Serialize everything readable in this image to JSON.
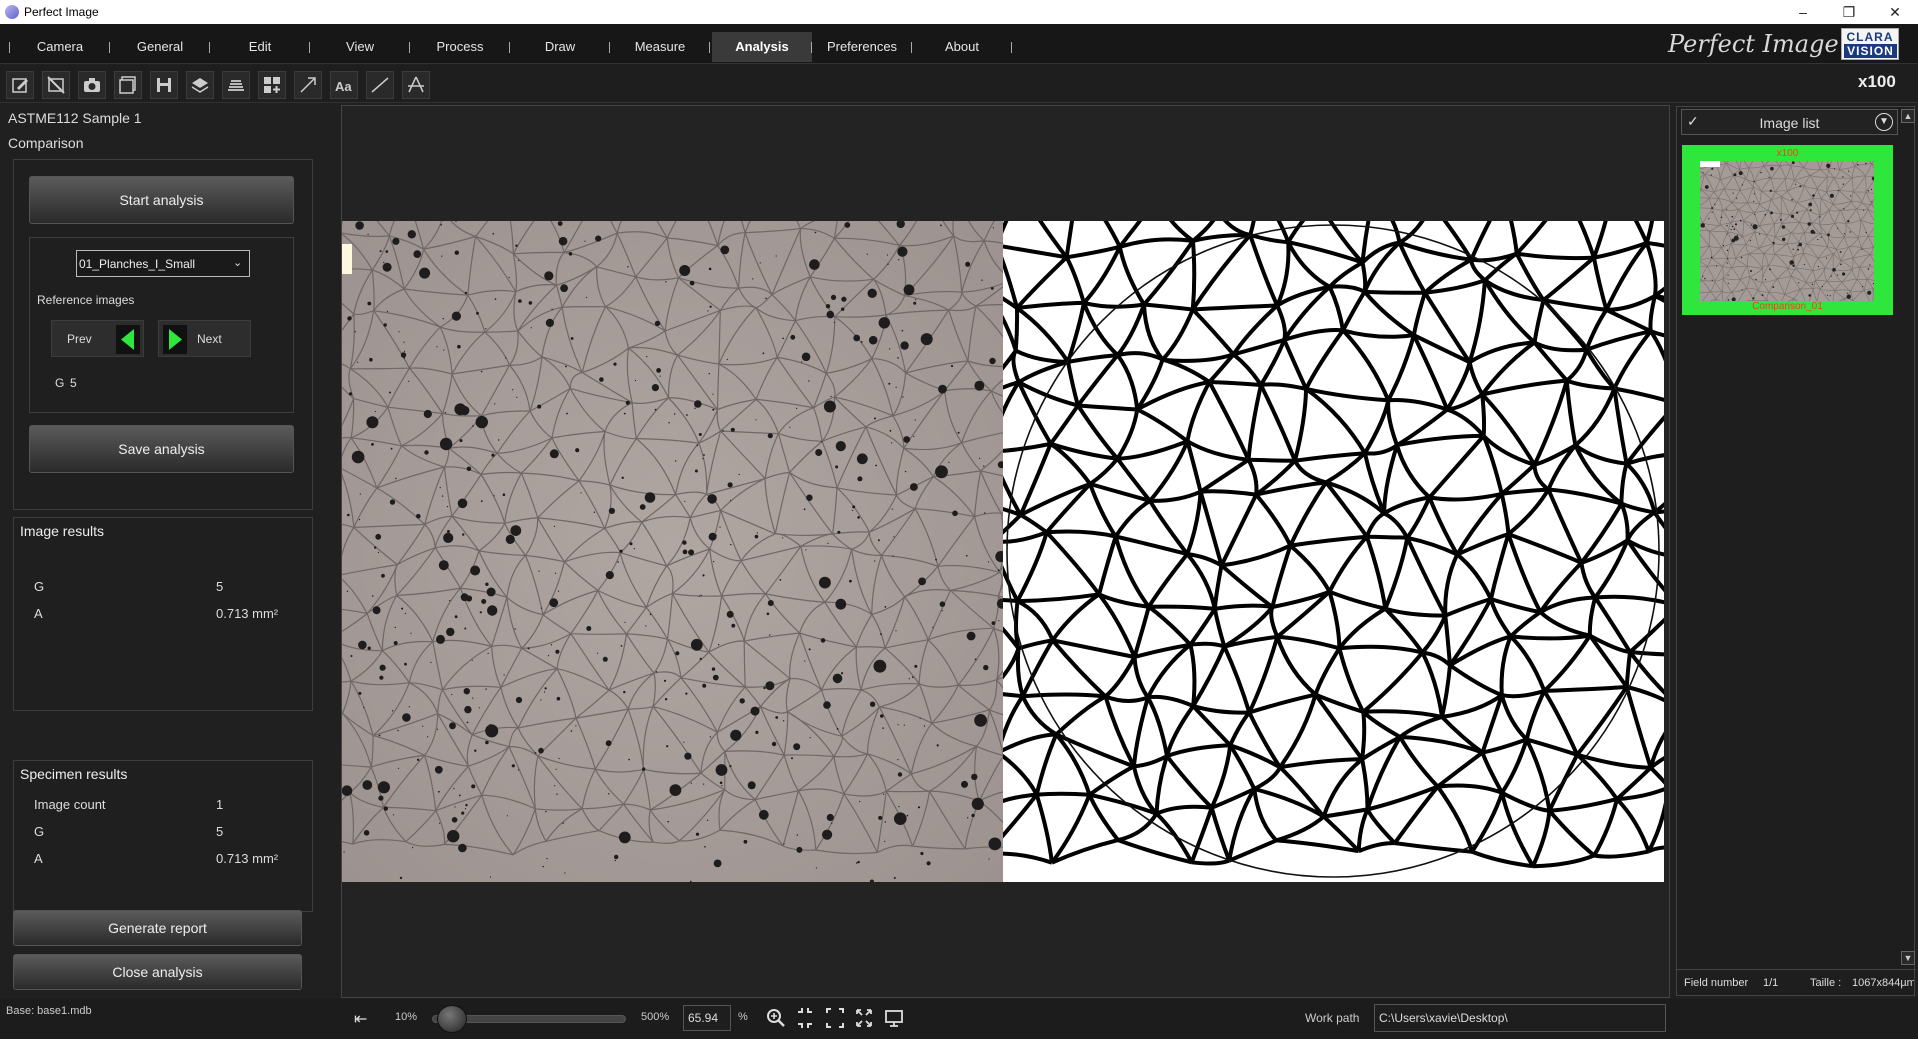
{
  "window": {
    "title": "Perfect Image",
    "minimize": "–",
    "restore": "❐",
    "close": "✕"
  },
  "menu": {
    "items": [
      "Camera",
      "General",
      "Edit",
      "View",
      "Process",
      "Draw",
      "Measure",
      "Analysis",
      "Preferences",
      "About"
    ],
    "active": "Analysis",
    "brand": "Perfect Image",
    "logo_line1": "CLARA",
    "logo_line2": "VISION"
  },
  "toolbar": {
    "tools": [
      "edit-icon",
      "no-image-icon",
      "camera-icon",
      "gallery-icon",
      "save-icon",
      "layers-icon",
      "stack-icon",
      "grid-add-icon",
      "arrow-icon",
      "text-tool-icon",
      "line-icon",
      "angle-icon"
    ],
    "magnification": "x100"
  },
  "left": {
    "header1": "ASTME112  Sample 1",
    "header2": "Comparison",
    "start_analysis": "Start analysis",
    "plate_select": "01_Planches_I_Small",
    "reference_images": "Reference images",
    "prev": "Prev",
    "next": "Next",
    "g_label": "G",
    "g_value": "5",
    "save_analysis": "Save analysis",
    "image_results": {
      "title": "Image results",
      "rows": [
        {
          "k": "G",
          "v": "5"
        },
        {
          "k": "A",
          "v": "0.713 mm²"
        }
      ]
    },
    "specimen_results": {
      "title": "Specimen results",
      "rows": [
        {
          "k": "Image count",
          "v": "1"
        },
        {
          "k": "G",
          "v": "5"
        },
        {
          "k": "A",
          "v": "0.713 mm²"
        }
      ]
    },
    "generate_report": "Generate report",
    "close_analysis": "Close analysis"
  },
  "right": {
    "image_list": "Image list",
    "thumb_top": "x100",
    "thumb_caption": "Comparison_01",
    "field_number_label": "Field number",
    "field_number": "1/1",
    "taille_label": "Taille :",
    "taille": "1067x844µm"
  },
  "bottom": {
    "base": "Base: base1.mdb",
    "zoom_min": "10%",
    "zoom_max": "500%",
    "zoom_value": "65.94",
    "zoom_unit": "%",
    "zoom_level": 0.05,
    "work_path_label": "Work path",
    "work_path": "C:\\Users\\xavie\\Desktop\\"
  },
  "colors": {
    "accent_green": "#2ee63c",
    "caption_red": "#ff3b1f",
    "micrograph": "#a59c98"
  }
}
